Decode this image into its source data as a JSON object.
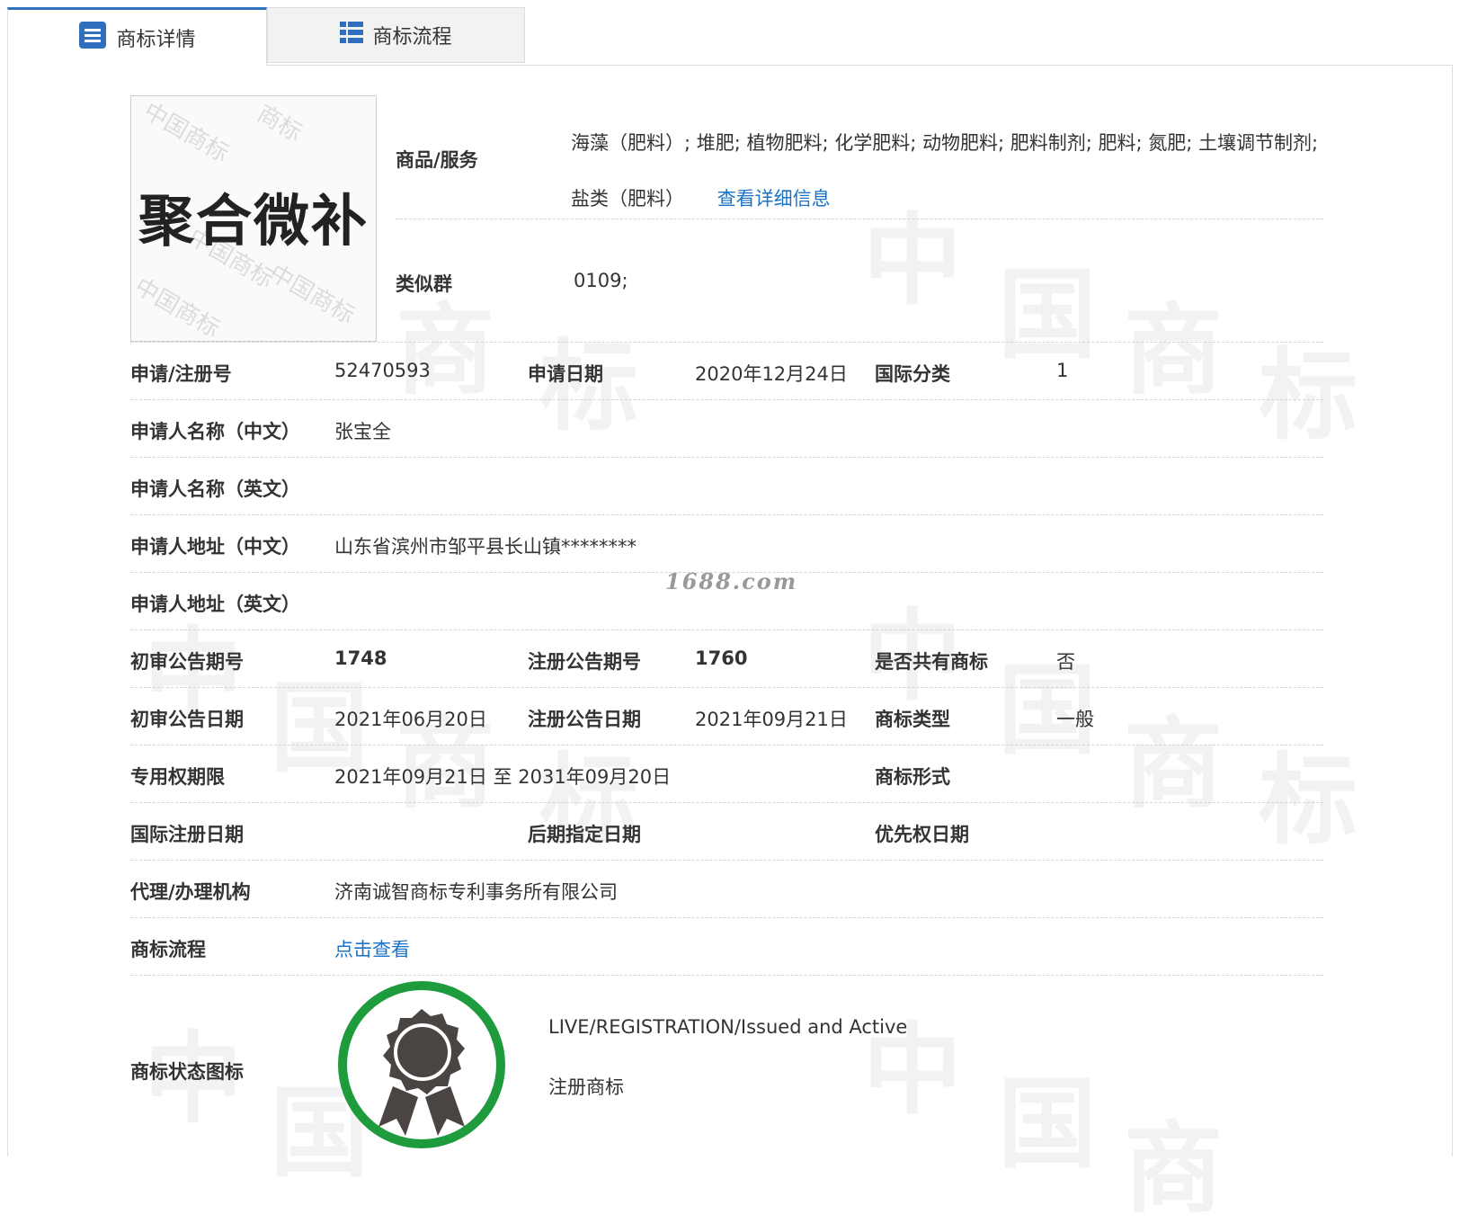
{
  "tabs": [
    {
      "label": "商标详情",
      "icon": "list-icon",
      "active": true
    },
    {
      "label": "商标流程",
      "icon": "grid-list-icon",
      "active": false
    }
  ],
  "trademark": {
    "image_text": "聚合微补"
  },
  "goods": {
    "label": "商品/服务",
    "value": "海藻（肥料）; 堆肥; 植物肥料; 化学肥料; 动物肥料; 肥料制剂; 肥料; 氮肥; 土壤调节制剂; 盐类（肥料）",
    "link": "查看详细信息"
  },
  "similar_group": {
    "label": "类似群",
    "value": "0109;"
  },
  "fields": {
    "reg_no": {
      "label": "申请/注册号",
      "value": "52470593"
    },
    "app_date": {
      "label": "申请日期",
      "value": "2020年12月24日"
    },
    "intl_class": {
      "label": "国际分类",
      "value": "1"
    },
    "applicant_cn": {
      "label": "申请人名称（中文）",
      "value": "张宝全"
    },
    "applicant_en": {
      "label": "申请人名称（英文）",
      "value": ""
    },
    "address_cn": {
      "label": "申请人地址（中文）",
      "value": "山东省滨州市邹平县长山镇********"
    },
    "address_en": {
      "label": "申请人地址（英文）",
      "value": ""
    },
    "prelim_issue": {
      "label": "初审公告期号",
      "value": "1748"
    },
    "reg_issue": {
      "label": "注册公告期号",
      "value": "1760"
    },
    "shared": {
      "label": "是否共有商标",
      "value": "否"
    },
    "prelim_date": {
      "label": "初审公告日期",
      "value": "2021年06月20日"
    },
    "reg_date": {
      "label": "注册公告日期",
      "value": "2021年09月21日"
    },
    "tm_type": {
      "label": "商标类型",
      "value": "一般"
    },
    "exclusive": {
      "label": "专用权期限",
      "value": "2021年09月21日 至 2031年09月20日"
    },
    "tm_form": {
      "label": "商标形式",
      "value": ""
    },
    "intl_reg_date": {
      "label": "国际注册日期",
      "value": ""
    },
    "later_date": {
      "label": "后期指定日期",
      "value": ""
    },
    "priority_date": {
      "label": "优先权日期",
      "value": ""
    },
    "agent": {
      "label": "代理/办理机构",
      "value": "济南诚智商标专利事务所有限公司"
    },
    "flow": {
      "label": "商标流程",
      "link": "点击查看"
    },
    "status_icon": {
      "label": "商标状态图标",
      "status_en": "LIVE/REGISTRATION/Issued and Active",
      "status_cn": "注册商标"
    }
  },
  "site_watermark": "1688.com",
  "colors": {
    "accent": "#2f6fbd",
    "link": "#1a73c7",
    "status_ring": "#1e9b3c"
  }
}
